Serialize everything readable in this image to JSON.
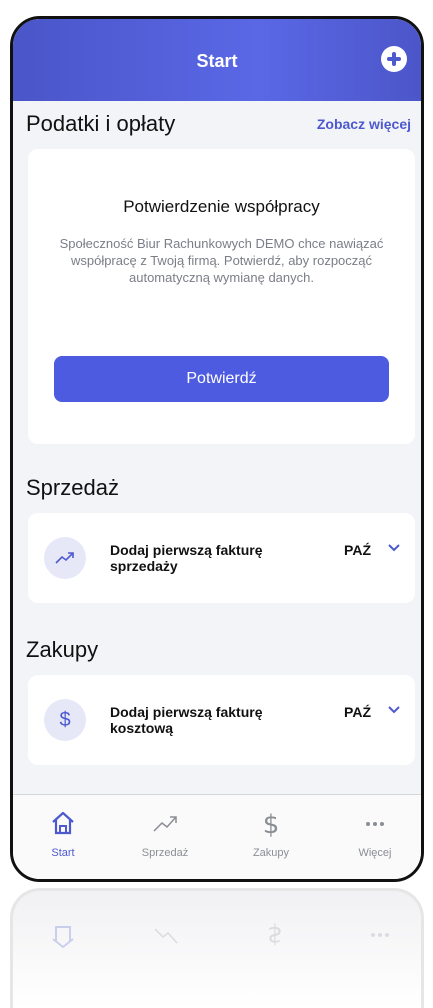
{
  "header": {
    "title": "Start",
    "add_icon": "plus-circle-icon"
  },
  "taxes": {
    "title": "Podatki i opłaty",
    "see_more": "Zobacz więcej",
    "confirm_title": "Potwierdzenie współpracy",
    "confirm_text": "Społeczność Biur Rachunkowych DEMO chce nawiązać współpracę z Twoją firmą. Potwierdź, aby rozpocząć automatyczną wymianę danych.",
    "confirm_button": "Potwierdź"
  },
  "sales": {
    "title": "Sprzedaż",
    "icon": "trending-up-icon",
    "text": "Dodaj pierwszą fakturę sprzedaży",
    "month": "PAŹ"
  },
  "purchases": {
    "title": "Zakupy",
    "icon": "dollar-icon",
    "text": "Dodaj pierwszą fakturę kosztową",
    "month": "PAŹ"
  },
  "tabs": [
    {
      "label": "Start",
      "icon": "home-icon",
      "active": true
    },
    {
      "label": "Sprzedaż",
      "icon": "trending-up-icon",
      "active": false
    },
    {
      "label": "Zakupy",
      "icon": "dollar-icon",
      "active": false
    },
    {
      "label": "Więcej",
      "icon": "more-icon",
      "active": false
    }
  ],
  "colors": {
    "accent": "#4d59cf",
    "header": "#5060d8",
    "background": "#f3f4f7"
  }
}
